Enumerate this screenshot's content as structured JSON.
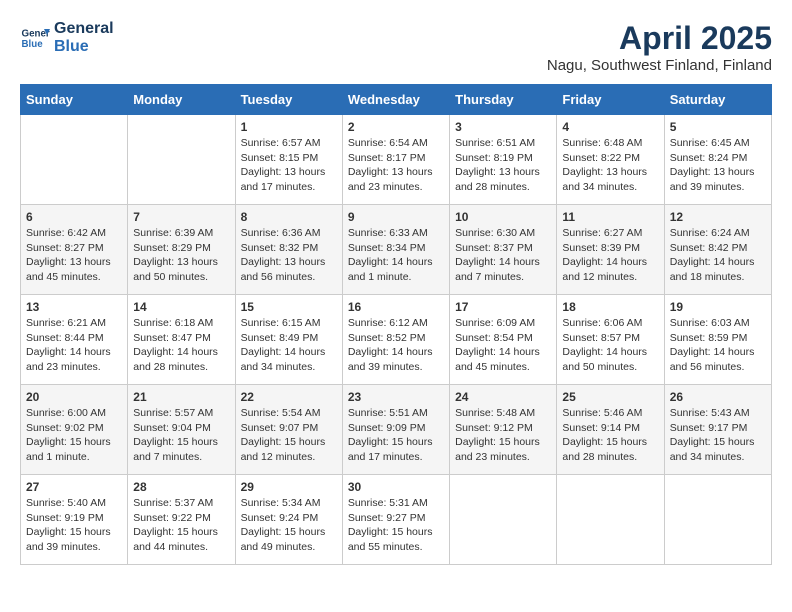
{
  "logo": {
    "line1": "General",
    "line2": "Blue"
  },
  "title": "April 2025",
  "location": "Nagu, Southwest Finland, Finland",
  "days_of_week": [
    "Sunday",
    "Monday",
    "Tuesday",
    "Wednesday",
    "Thursday",
    "Friday",
    "Saturday"
  ],
  "weeks": [
    [
      {
        "day": "",
        "info": ""
      },
      {
        "day": "",
        "info": ""
      },
      {
        "day": "1",
        "info": "Sunrise: 6:57 AM\nSunset: 8:15 PM\nDaylight: 13 hours and 17 minutes."
      },
      {
        "day": "2",
        "info": "Sunrise: 6:54 AM\nSunset: 8:17 PM\nDaylight: 13 hours and 23 minutes."
      },
      {
        "day": "3",
        "info": "Sunrise: 6:51 AM\nSunset: 8:19 PM\nDaylight: 13 hours and 28 minutes."
      },
      {
        "day": "4",
        "info": "Sunrise: 6:48 AM\nSunset: 8:22 PM\nDaylight: 13 hours and 34 minutes."
      },
      {
        "day": "5",
        "info": "Sunrise: 6:45 AM\nSunset: 8:24 PM\nDaylight: 13 hours and 39 minutes."
      }
    ],
    [
      {
        "day": "6",
        "info": "Sunrise: 6:42 AM\nSunset: 8:27 PM\nDaylight: 13 hours and 45 minutes."
      },
      {
        "day": "7",
        "info": "Sunrise: 6:39 AM\nSunset: 8:29 PM\nDaylight: 13 hours and 50 minutes."
      },
      {
        "day": "8",
        "info": "Sunrise: 6:36 AM\nSunset: 8:32 PM\nDaylight: 13 hours and 56 minutes."
      },
      {
        "day": "9",
        "info": "Sunrise: 6:33 AM\nSunset: 8:34 PM\nDaylight: 14 hours and 1 minute."
      },
      {
        "day": "10",
        "info": "Sunrise: 6:30 AM\nSunset: 8:37 PM\nDaylight: 14 hours and 7 minutes."
      },
      {
        "day": "11",
        "info": "Sunrise: 6:27 AM\nSunset: 8:39 PM\nDaylight: 14 hours and 12 minutes."
      },
      {
        "day": "12",
        "info": "Sunrise: 6:24 AM\nSunset: 8:42 PM\nDaylight: 14 hours and 18 minutes."
      }
    ],
    [
      {
        "day": "13",
        "info": "Sunrise: 6:21 AM\nSunset: 8:44 PM\nDaylight: 14 hours and 23 minutes."
      },
      {
        "day": "14",
        "info": "Sunrise: 6:18 AM\nSunset: 8:47 PM\nDaylight: 14 hours and 28 minutes."
      },
      {
        "day": "15",
        "info": "Sunrise: 6:15 AM\nSunset: 8:49 PM\nDaylight: 14 hours and 34 minutes."
      },
      {
        "day": "16",
        "info": "Sunrise: 6:12 AM\nSunset: 8:52 PM\nDaylight: 14 hours and 39 minutes."
      },
      {
        "day": "17",
        "info": "Sunrise: 6:09 AM\nSunset: 8:54 PM\nDaylight: 14 hours and 45 minutes."
      },
      {
        "day": "18",
        "info": "Sunrise: 6:06 AM\nSunset: 8:57 PM\nDaylight: 14 hours and 50 minutes."
      },
      {
        "day": "19",
        "info": "Sunrise: 6:03 AM\nSunset: 8:59 PM\nDaylight: 14 hours and 56 minutes."
      }
    ],
    [
      {
        "day": "20",
        "info": "Sunrise: 6:00 AM\nSunset: 9:02 PM\nDaylight: 15 hours and 1 minute."
      },
      {
        "day": "21",
        "info": "Sunrise: 5:57 AM\nSunset: 9:04 PM\nDaylight: 15 hours and 7 minutes."
      },
      {
        "day": "22",
        "info": "Sunrise: 5:54 AM\nSunset: 9:07 PM\nDaylight: 15 hours and 12 minutes."
      },
      {
        "day": "23",
        "info": "Sunrise: 5:51 AM\nSunset: 9:09 PM\nDaylight: 15 hours and 17 minutes."
      },
      {
        "day": "24",
        "info": "Sunrise: 5:48 AM\nSunset: 9:12 PM\nDaylight: 15 hours and 23 minutes."
      },
      {
        "day": "25",
        "info": "Sunrise: 5:46 AM\nSunset: 9:14 PM\nDaylight: 15 hours and 28 minutes."
      },
      {
        "day": "26",
        "info": "Sunrise: 5:43 AM\nSunset: 9:17 PM\nDaylight: 15 hours and 34 minutes."
      }
    ],
    [
      {
        "day": "27",
        "info": "Sunrise: 5:40 AM\nSunset: 9:19 PM\nDaylight: 15 hours and 39 minutes."
      },
      {
        "day": "28",
        "info": "Sunrise: 5:37 AM\nSunset: 9:22 PM\nDaylight: 15 hours and 44 minutes."
      },
      {
        "day": "29",
        "info": "Sunrise: 5:34 AM\nSunset: 9:24 PM\nDaylight: 15 hours and 49 minutes."
      },
      {
        "day": "30",
        "info": "Sunrise: 5:31 AM\nSunset: 9:27 PM\nDaylight: 15 hours and 55 minutes."
      },
      {
        "day": "",
        "info": ""
      },
      {
        "day": "",
        "info": ""
      },
      {
        "day": "",
        "info": ""
      }
    ]
  ]
}
